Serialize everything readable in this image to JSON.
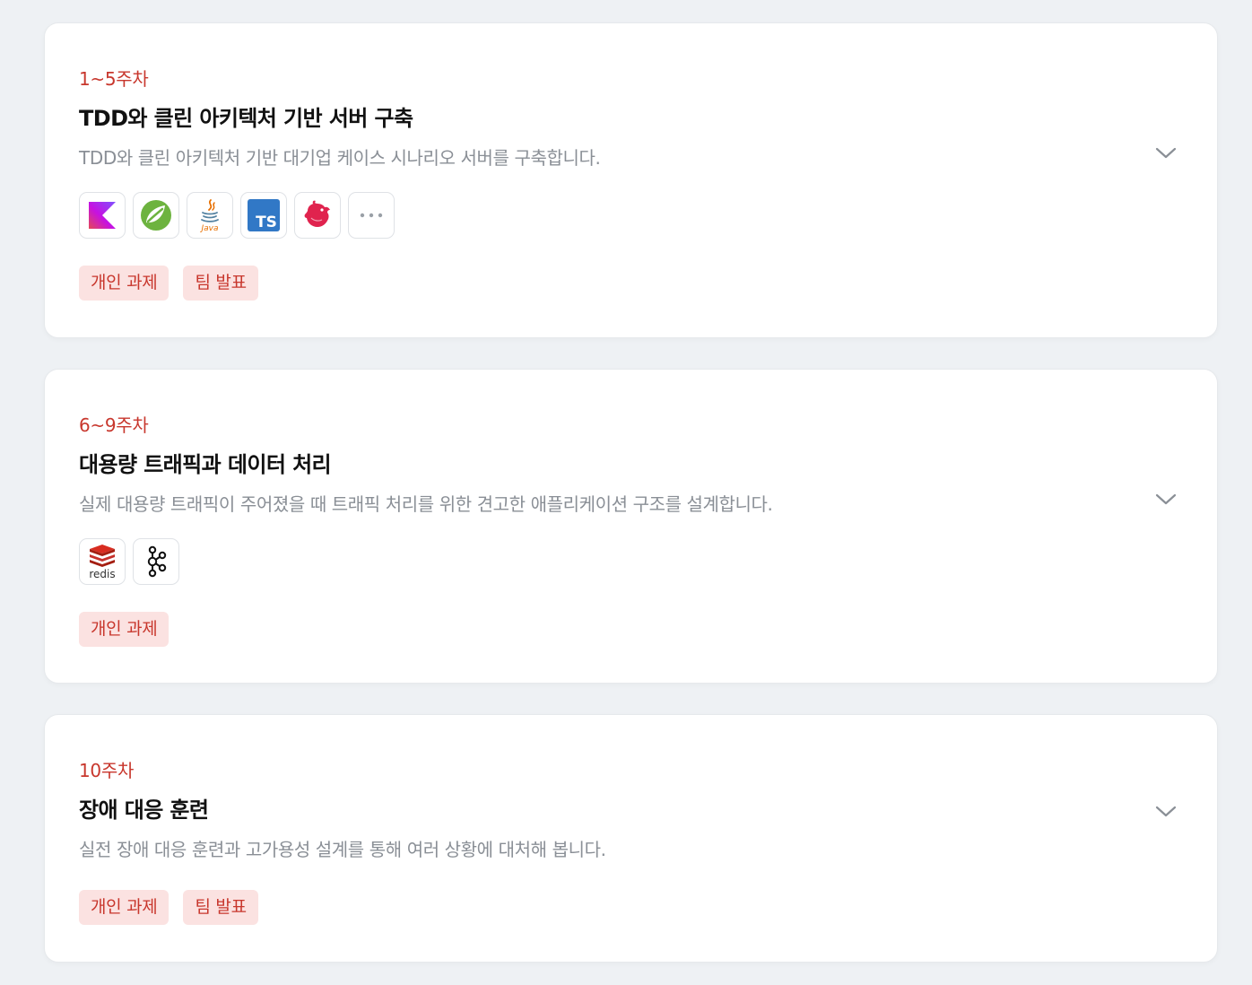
{
  "colors": {
    "accent": "#c8372d",
    "tag_bg": "#fbe2e1",
    "title": "#111111",
    "description": "#8a8f96",
    "page_bg": "#eef1f4"
  },
  "courses": [
    {
      "week": "1~5주차",
      "title": "TDD와 클린 아키텍처 기반 서버 구축",
      "description": "TDD와 클린 아키텍처 기반 대기업 케이스 시나리오 서버를 구축합니다.",
      "tech_icons": [
        "kotlin-icon",
        "spring-icon",
        "java-icon",
        "typescript-icon",
        "nestjs-icon",
        "more-icon"
      ],
      "java_label": "Java",
      "ts_label": "TS",
      "tags": [
        "개인 과제",
        "팀 발표"
      ]
    },
    {
      "week": "6~9주차",
      "title": "대용량 트래픽과 데이터 처리",
      "description": "실제 대용량 트래픽이 주어졌을 때 트래픽 처리를 위한 견고한 애플리케이션 구조를 설계합니다.",
      "tech_icons": [
        "redis-icon",
        "kafka-icon"
      ],
      "redis_label": "redis",
      "tags": [
        "개인 과제"
      ]
    },
    {
      "week": "10주차",
      "title": "장애 대응 훈련",
      "description": "실전 장애 대응 훈련과 고가용성 설계를 통해 여러 상황에 대처해 봅니다.",
      "tech_icons": [],
      "tags": [
        "개인 과제",
        "팀 발표"
      ]
    }
  ]
}
